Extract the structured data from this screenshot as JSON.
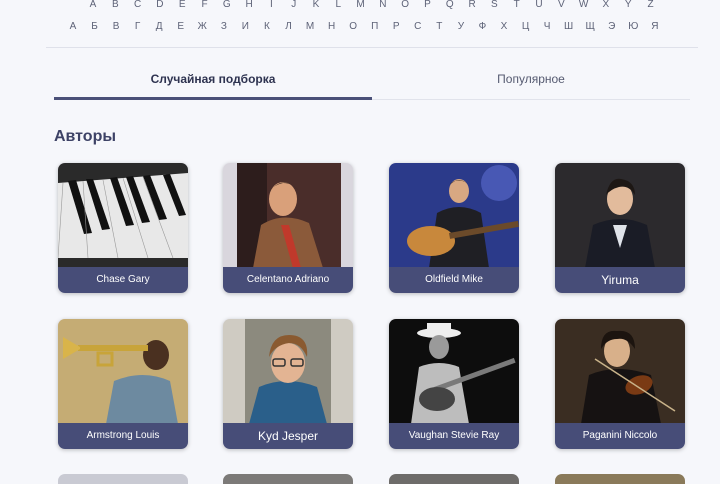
{
  "alphabet": {
    "latin": [
      "A",
      "B",
      "C",
      "D",
      "E",
      "F",
      "G",
      "H",
      "I",
      "J",
      "K",
      "L",
      "M",
      "N",
      "O",
      "P",
      "Q",
      "R",
      "S",
      "T",
      "U",
      "V",
      "W",
      "X",
      "Y",
      "Z"
    ],
    "cyrillic": [
      "А",
      "Б",
      "В",
      "Г",
      "Д",
      "Е",
      "Ж",
      "З",
      "И",
      "К",
      "Л",
      "М",
      "Н",
      "О",
      "П",
      "Р",
      "С",
      "Т",
      "У",
      "Ф",
      "Х",
      "Ц",
      "Ч",
      "Ш",
      "Щ",
      "Э",
      "Ю",
      "Я"
    ]
  },
  "tabs": [
    {
      "label": "Случайная подборка",
      "active": true
    },
    {
      "label": "Популярное",
      "active": false
    }
  ],
  "section_title": "Авторы",
  "authors": [
    {
      "name": "Chase Gary",
      "photo": "piano-keys-photo"
    },
    {
      "name": "Celentano Adriano",
      "photo": "portrait-photo"
    },
    {
      "name": "Oldfield Mike",
      "photo": "guitarist-photo"
    },
    {
      "name": "Yiruma",
      "photo": "portrait-photo"
    },
    {
      "name": "Armstrong Louis",
      "photo": "trumpeter-photo"
    },
    {
      "name": "Kyd Jesper",
      "photo": "portrait-photo"
    },
    {
      "name": "Vaughan Stevie Ray",
      "photo": "guitarist-photo"
    },
    {
      "name": "Paganini Niccolo",
      "photo": "violinist-painting"
    }
  ],
  "colors": {
    "accent": "#474d78",
    "background": "#f6f7fb"
  }
}
